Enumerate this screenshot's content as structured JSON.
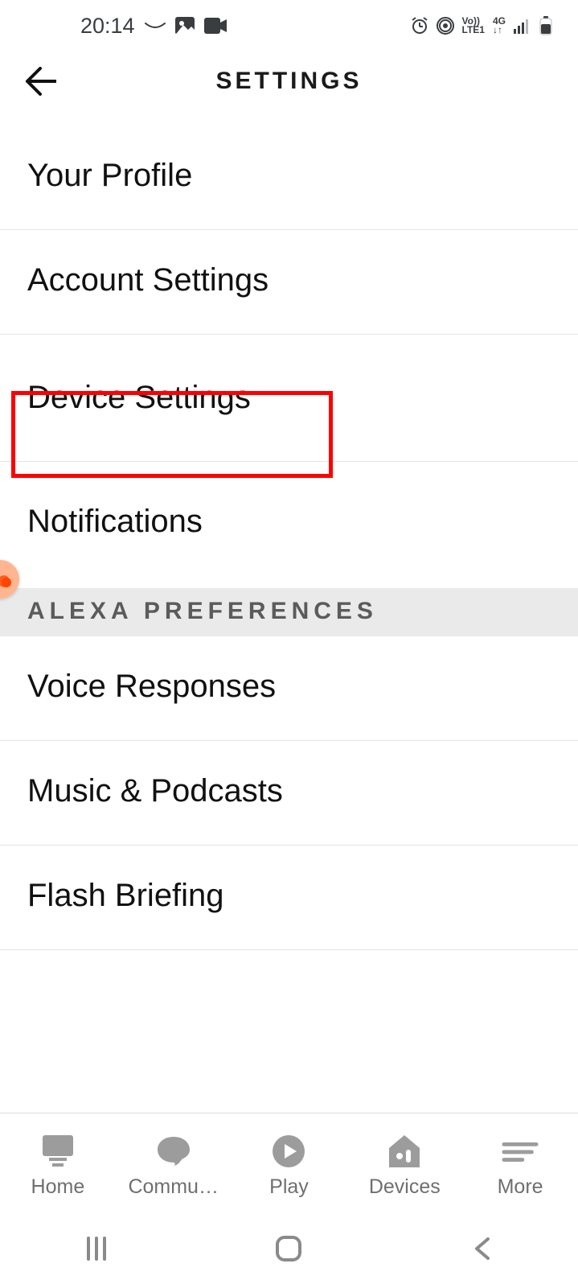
{
  "status": {
    "time": "20:14",
    "lte_top": "Vo))",
    "lte_bottom": "LTE1",
    "net": "4G"
  },
  "header": {
    "title": "SETTINGS"
  },
  "settings": {
    "items": [
      {
        "label": "Your Profile"
      },
      {
        "label": "Account Settings"
      },
      {
        "label": "Device Settings"
      },
      {
        "label": "Notifications"
      }
    ]
  },
  "section_header": "ALEXA PREFERENCES",
  "prefs": {
    "items": [
      {
        "label": "Voice Responses"
      },
      {
        "label": "Music & Podcasts"
      },
      {
        "label": "Flash Briefing"
      }
    ]
  },
  "bottom_nav": {
    "items": [
      {
        "label": "Home"
      },
      {
        "label": "Commu…"
      },
      {
        "label": "Play"
      },
      {
        "label": "Devices"
      },
      {
        "label": "More"
      }
    ]
  }
}
